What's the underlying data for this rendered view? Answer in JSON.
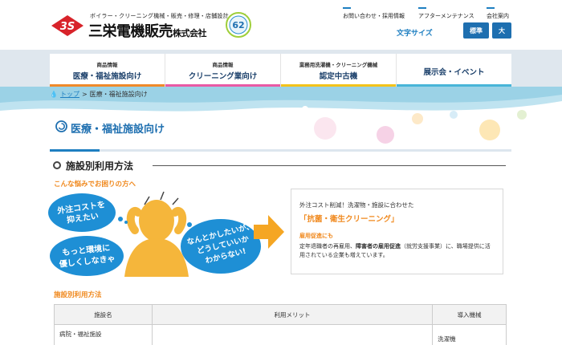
{
  "header": {
    "tagline": "ボイラー・クリーニング機械・販売・修理・店舗設計・施工",
    "company_name": "三栄電機販売",
    "company_suffix": "株式会社",
    "anniversary_number": "62",
    "links": [
      "お問い合わせ・採用情報",
      "アフターメンテナンス",
      "会社案内"
    ],
    "font_size_label": "文字サイズ",
    "font_size_standard": "標準",
    "font_size_large": "大"
  },
  "nav": {
    "items": [
      {
        "small": "商品情報",
        "big": "医療・福祉施設向け",
        "color": "#f08a2a"
      },
      {
        "small": "商品情報",
        "big": "クリーニング業向け",
        "color": "#e95aa5"
      },
      {
        "small": "業務用洗濯機・クリーニング機械",
        "big": "認定中古機",
        "color": "#f3c31b"
      },
      {
        "small": "",
        "big": "展示会・イベント",
        "color": "#48b5d8"
      }
    ]
  },
  "breadcrumb": {
    "home": "トップ",
    "separator": ">",
    "current": "医療・福祉施設向け"
  },
  "hero": {
    "title": "医療・福祉施設向け"
  },
  "section": {
    "title": "施設別利用方法",
    "worry_label": "こんな悩みでお困りの方へ",
    "bubbles": [
      "外注コストを抑えたい",
      "もっと環境に優しくしなきゃ",
      "なんとかしたいが、どうしていいかわからない!"
    ],
    "info": {
      "lead": "外注コスト削減！洗濯物・施設に合わせた",
      "highlight": "「抗菌・衛生クリーニング」",
      "sub": "雇用促進にも",
      "body_pre": "定年退職者の再雇用、",
      "body_bold": "障害者の雇用促進",
      "body_post": "（就労支援事業）に、職場提供に活用されている企業も増えています。"
    }
  },
  "table": {
    "label": "施設別利用方法",
    "headers": [
      "施設名",
      "利用メリット",
      "導入機械"
    ],
    "rows": [
      {
        "facility": "病院・福祉施設",
        "merit": "",
        "equipment": "洗濯機"
      }
    ]
  },
  "colors": {
    "accent": "#1e7fc1",
    "orange": "#f0891e",
    "navy": "#1a3f6a"
  }
}
